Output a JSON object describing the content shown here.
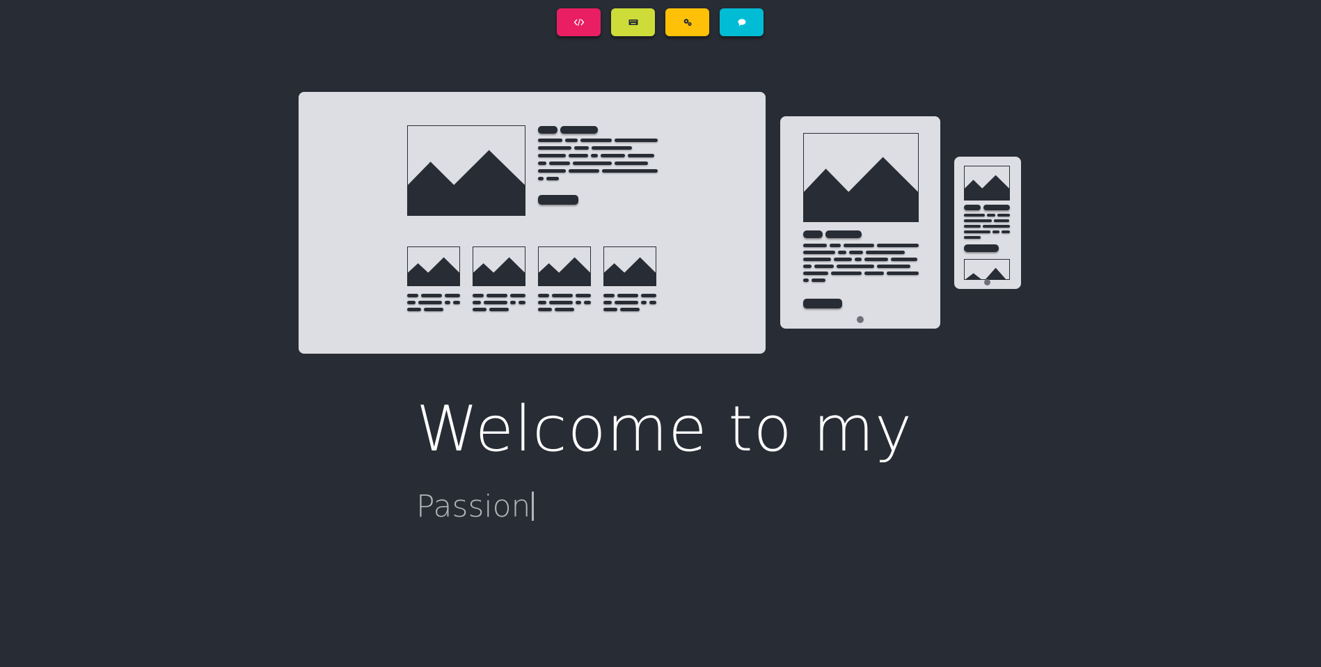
{
  "nav": {
    "buttons": [
      {
        "name": "code",
        "icon": "code-icon",
        "color": "#e91e63"
      },
      {
        "name": "keyboard",
        "icon": "keyboard-icon",
        "color": "#cddc39"
      },
      {
        "name": "settings",
        "icon": "gears-icon",
        "color": "#ffc107"
      },
      {
        "name": "chat",
        "icon": "chat-bubble-icon",
        "color": "#00bcd4"
      }
    ]
  },
  "illustration": {
    "devices": [
      "desktop",
      "tablet",
      "phone"
    ],
    "device_color": "#dcdee3",
    "ink_color": "#282c34"
  },
  "hero": {
    "title": "Welcome to my",
    "subtitle": "Passion"
  },
  "theme": {
    "background": "#282c34"
  }
}
